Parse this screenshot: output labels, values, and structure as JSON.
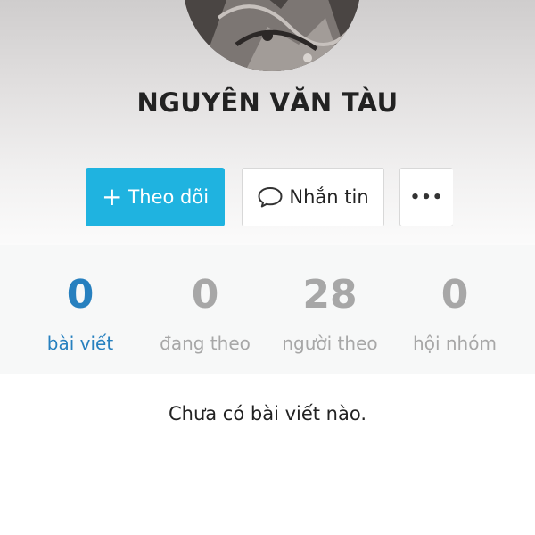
{
  "profile": {
    "name": "NGUYÊN VĂN TÀU"
  },
  "actions": {
    "follow_label": "Theo dõi",
    "follow_icon": "plus-icon",
    "message_label": "Nhắn tin",
    "message_icon": "chat-bubble-icon",
    "more_label": "•••",
    "more_icon": "more-dots-icon"
  },
  "stats": [
    {
      "value": "0",
      "label": "bài viết",
      "active": true
    },
    {
      "value": "0",
      "label": "đang theo",
      "active": false
    },
    {
      "value": "28",
      "label": "người theo",
      "active": false
    },
    {
      "value": "0",
      "label": "hội nhóm",
      "active": false
    }
  ],
  "posts": {
    "empty_message": "Chưa có bài viết nào."
  },
  "colors": {
    "accent": "#1fb3e0",
    "active_stat": "#2780bf",
    "inactive_stat": "#a7a7a7"
  }
}
